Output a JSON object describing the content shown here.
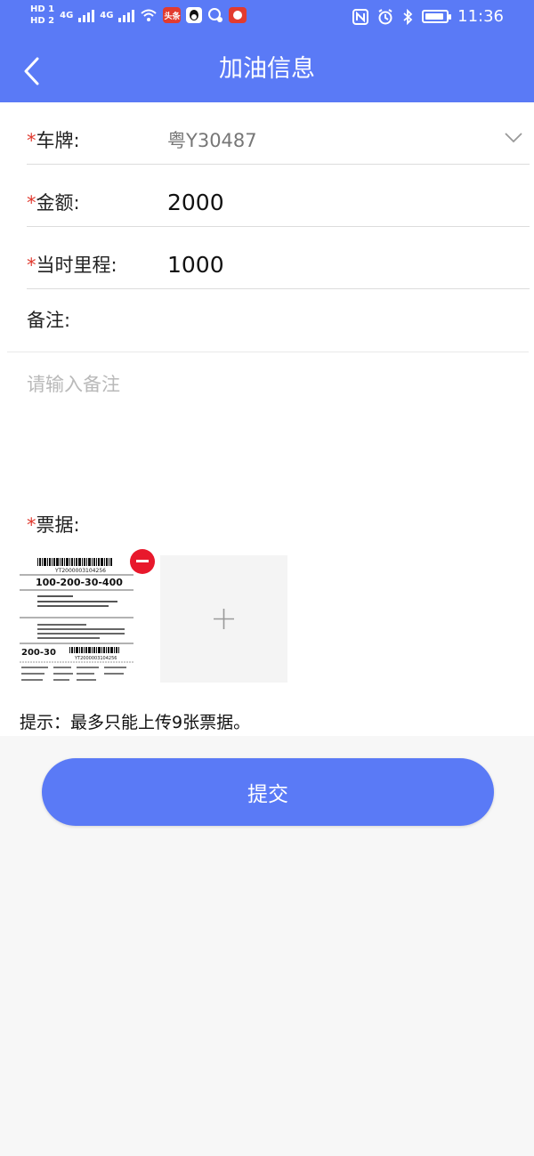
{
  "status_bar": {
    "sim1": "HD 1",
    "sim2": "HD 2",
    "network1": "4G",
    "network2": "4G",
    "app_badge": "头条",
    "time": "11:36",
    "icons": [
      "nfc-icon",
      "alarm-icon",
      "bluetooth-icon",
      "battery-charging-icon"
    ]
  },
  "header": {
    "title": "加油信息",
    "back_icon": "chevron-left-icon"
  },
  "form": {
    "plate": {
      "required": "*",
      "label": "车牌:",
      "value": "粤Y30487"
    },
    "amount": {
      "required": "*",
      "label": "金额:",
      "value": "2000"
    },
    "mileage": {
      "required": "*",
      "label": "当时里程:",
      "value": "1000"
    },
    "note": {
      "label": "备注:",
      "placeholder": "请输入备注",
      "value": ""
    },
    "receipts": {
      "required": "*",
      "label": "票据:",
      "thumbnail_text": {
        "barcode_top": "YT2000003104256",
        "tracking": "100-200-30-400",
        "code": "200-30",
        "barcode_bottom": "YT2000003104256"
      },
      "hint": "提示：最多只能上传9张票据。"
    }
  },
  "submit_label": "提交",
  "colors": {
    "primary": "#5a7af6",
    "required": "#e03a2f",
    "remove": "#e8182c"
  }
}
